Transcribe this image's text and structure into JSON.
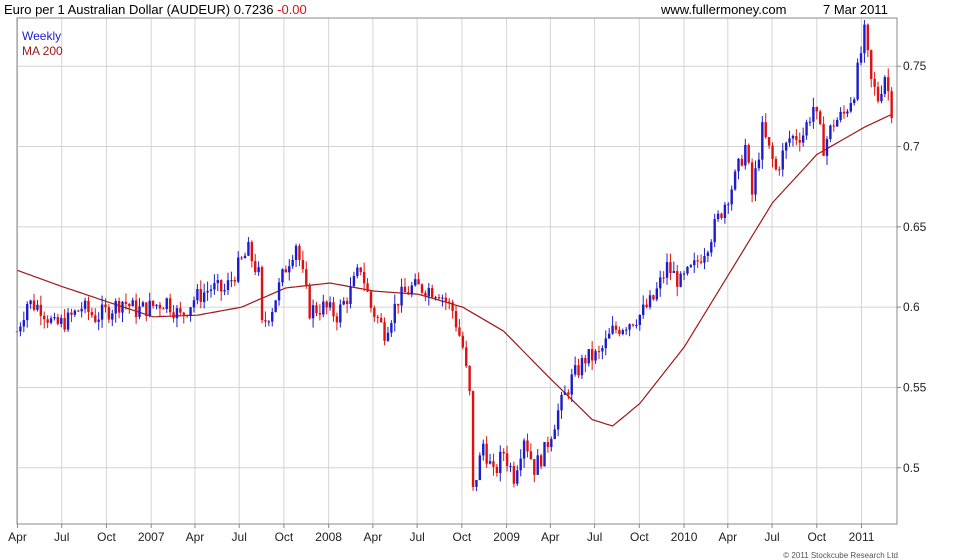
{
  "header": {
    "title": "Euro per 1 Australian Dollar (AUDEUR) 0.7236",
    "change": "-0.00",
    "source": "www.fullermoney.com",
    "date": "7 Mar 2011"
  },
  "legend": {
    "weekly": "Weekly",
    "ma": "MA 200"
  },
  "footer": "© 2011 Stockcube Research Ltd",
  "colors": {
    "up": "#1c1ccf",
    "down": "#e01010",
    "ma": "#a01818",
    "grid": "#d4d4d4"
  },
  "chart_data": {
    "type": "candlestick",
    "title": "Euro per 1 Australian Dollar (AUDEUR)",
    "last": 0.7236,
    "change": -0.0,
    "frequency": "Weekly",
    "ylim": [
      0.465,
      0.78
    ],
    "y_ticks": [
      0.5,
      0.55,
      0.6,
      0.65,
      0.7,
      0.75
    ],
    "x_ticks": [
      "Apr",
      "Jul",
      "Oct",
      "2007",
      "Apr",
      "Jul",
      "Oct",
      "2008",
      "Apr",
      "Jul",
      "Oct",
      "2009",
      "Apr",
      "Jul",
      "Oct",
      "2010",
      "Apr",
      "Jul",
      "Oct",
      "2011"
    ],
    "x_start": "2006-03-31",
    "x_end": "2011-03-15",
    "close_anchors": [
      [
        "2006-03-31",
        0.585
      ],
      [
        "2006-04-21",
        0.603
      ],
      [
        "2006-05-19",
        0.6
      ],
      [
        "2006-06-16",
        0.588
      ],
      [
        "2006-07-14",
        0.592
      ],
      [
        "2006-08-11",
        0.6
      ],
      [
        "2006-09-08",
        0.594
      ],
      [
        "2006-10-06",
        0.598
      ],
      [
        "2006-11-03",
        0.604
      ],
      [
        "2006-12-01",
        0.598
      ],
      [
        "2006-12-29",
        0.6
      ],
      [
        "2007-02-02",
        0.604
      ],
      [
        "2007-03-02",
        0.594
      ],
      [
        "2007-03-30",
        0.605
      ],
      [
        "2007-05-04",
        0.612
      ],
      [
        "2007-06-01",
        0.61
      ],
      [
        "2007-06-29",
        0.625
      ],
      [
        "2007-07-20",
        0.635
      ],
      [
        "2007-08-10",
        0.62
      ],
      [
        "2007-08-17",
        0.588
      ],
      [
        "2007-09-07",
        0.6
      ],
      [
        "2007-10-05",
        0.625
      ],
      [
        "2007-10-26",
        0.64
      ],
      [
        "2007-11-23",
        0.598
      ],
      [
        "2007-12-21",
        0.6
      ],
      [
        "2008-01-18",
        0.595
      ],
      [
        "2008-02-15",
        0.61
      ],
      [
        "2008-03-07",
        0.625
      ],
      [
        "2008-03-28",
        0.6
      ],
      [
        "2008-04-25",
        0.585
      ],
      [
        "2008-05-23",
        0.605
      ],
      [
        "2008-06-20",
        0.612
      ],
      [
        "2008-07-18",
        0.612
      ],
      [
        "2008-08-15",
        0.61
      ],
      [
        "2008-09-12",
        0.598
      ],
      [
        "2008-10-03",
        0.575
      ],
      [
        "2008-10-17",
        0.545
      ],
      [
        "2008-10-24",
        0.485
      ],
      [
        "2008-11-14",
        0.515
      ],
      [
        "2008-12-05",
        0.495
      ],
      [
        "2008-12-26",
        0.51
      ],
      [
        "2009-01-16",
        0.495
      ],
      [
        "2009-02-06",
        0.52
      ],
      [
        "2009-02-27",
        0.5
      ],
      [
        "2009-03-20",
        0.51
      ],
      [
        "2009-04-17",
        0.535
      ],
      [
        "2009-05-15",
        0.555
      ],
      [
        "2009-06-12",
        0.568
      ],
      [
        "2009-07-10",
        0.57
      ],
      [
        "2009-08-07",
        0.585
      ],
      [
        "2009-09-04",
        0.59
      ],
      [
        "2009-10-02",
        0.595
      ],
      [
        "2009-10-30",
        0.605
      ],
      [
        "2009-11-27",
        0.625
      ],
      [
        "2009-12-25",
        0.615
      ],
      [
        "2010-01-22",
        0.625
      ],
      [
        "2010-02-19",
        0.64
      ],
      [
        "2010-03-19",
        0.66
      ],
      [
        "2010-04-16",
        0.68
      ],
      [
        "2010-05-07",
        0.7
      ],
      [
        "2010-05-21",
        0.67
      ],
      [
        "2010-06-11",
        0.71
      ],
      [
        "2010-07-09",
        0.685
      ],
      [
        "2010-08-06",
        0.705
      ],
      [
        "2010-09-03",
        0.708
      ],
      [
        "2010-09-24",
        0.725
      ],
      [
        "2010-10-15",
        0.7
      ],
      [
        "2010-11-05",
        0.715
      ],
      [
        "2010-11-26",
        0.72
      ],
      [
        "2010-12-17",
        0.735
      ],
      [
        "2011-01-07",
        0.77
      ],
      [
        "2011-01-21",
        0.74
      ],
      [
        "2011-02-04",
        0.73
      ],
      [
        "2011-02-18",
        0.745
      ],
      [
        "2011-03-04",
        0.7236
      ]
    ],
    "ma200_anchors": [
      [
        "2006-03-31",
        0.623
      ],
      [
        "2006-06-30",
        0.613
      ],
      [
        "2006-10-06",
        0.603
      ],
      [
        "2007-01-05",
        0.594
      ],
      [
        "2007-04-06",
        0.595
      ],
      [
        "2007-07-06",
        0.6
      ],
      [
        "2007-10-05",
        0.612
      ],
      [
        "2008-01-04",
        0.615
      ],
      [
        "2008-04-04",
        0.61
      ],
      [
        "2008-07-04",
        0.608
      ],
      [
        "2008-10-03",
        0.6
      ],
      [
        "2008-12-26",
        0.585
      ],
      [
        "2009-03-27",
        0.557
      ],
      [
        "2009-06-26",
        0.53
      ],
      [
        "2009-08-07",
        0.526
      ],
      [
        "2009-10-02",
        0.54
      ],
      [
        "2010-01-01",
        0.575
      ],
      [
        "2010-04-02",
        0.62
      ],
      [
        "2010-07-02",
        0.665
      ],
      [
        "2010-10-01",
        0.695
      ],
      [
        "2011-01-07",
        0.712
      ],
      [
        "2011-03-04",
        0.72
      ]
    ]
  }
}
